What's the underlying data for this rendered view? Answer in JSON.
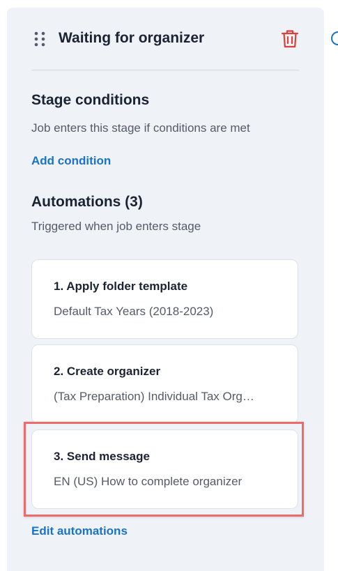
{
  "stage": {
    "title": "Waiting for organizer"
  },
  "conditions": {
    "title": "Stage conditions",
    "subtitle": "Job enters this stage if conditions are met",
    "add_link": "Add condition"
  },
  "automations": {
    "title": "Automations (3)",
    "subtitle": "Triggered when job enters stage",
    "items": [
      {
        "title": "1. Apply folder template",
        "description": "Default Tax Years (2018-2023)"
      },
      {
        "title": "2. Create organizer",
        "description": "(Tax Preparation) Individual Tax Organizer"
      },
      {
        "title": "3. Send message",
        "description": "EN (US) How to complete organizer"
      }
    ],
    "edit_link": "Edit automations"
  },
  "colors": {
    "panel_bg": "#eff2f7",
    "link": "#1a73c8",
    "trash": "#d9413a",
    "highlight": "#ee6b6b"
  },
  "icons": {
    "drag": "drag-handle-icon",
    "delete": "trash-icon",
    "edge": "info-circle-icon"
  }
}
